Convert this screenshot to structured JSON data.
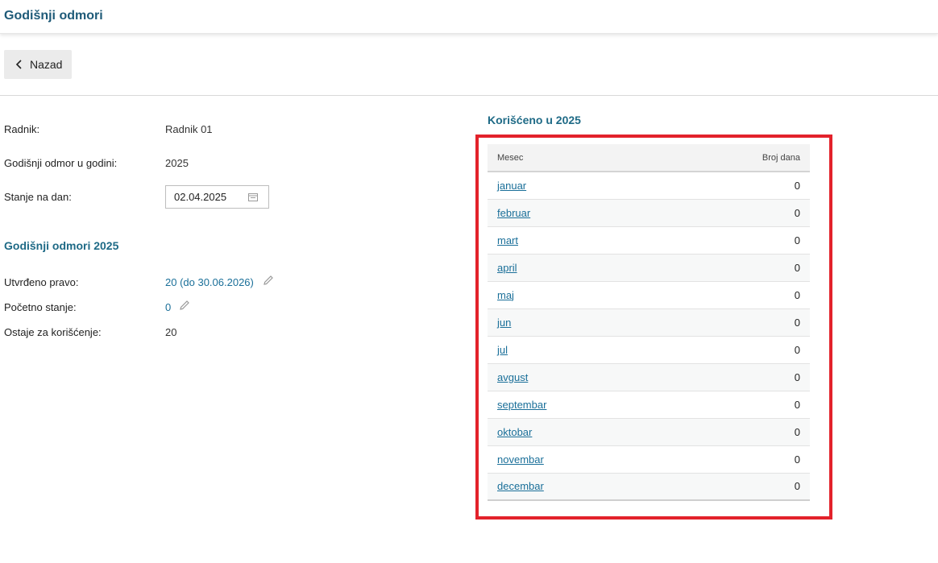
{
  "header": {
    "title": "Godišnji odmori"
  },
  "toolbar": {
    "back_label": "Nazad"
  },
  "details": {
    "worker_label": "Radnik:",
    "worker_value": "Radnik 01",
    "year_label": "Godišnji odmor u godini:",
    "year_value": "2025",
    "balance_date_label": "Stanje na dan:",
    "balance_date_value": "02.04.2025"
  },
  "summary": {
    "title": "Godišnji odmori 2025",
    "entitlement_label": "Utvrđeno pravo:",
    "entitlement_value": "20 (do 30.06.2026)",
    "opening_label": "Početno stanje:",
    "opening_value": "0",
    "remaining_label": "Ostaje za korišćenje:",
    "remaining_value": "20"
  },
  "usage": {
    "title": "Korišćeno u 2025",
    "columns": {
      "month": "Mesec",
      "days": "Broj dana"
    },
    "rows": [
      {
        "month": "januar",
        "days": "0"
      },
      {
        "month": "februar",
        "days": "0"
      },
      {
        "month": "mart",
        "days": "0"
      },
      {
        "month": "april",
        "days": "0"
      },
      {
        "month": "maj",
        "days": "0"
      },
      {
        "month": "jun",
        "days": "0"
      },
      {
        "month": "jul",
        "days": "0"
      },
      {
        "month": "avgust",
        "days": "0"
      },
      {
        "month": "septembar",
        "days": "0"
      },
      {
        "month": "oktobar",
        "days": "0"
      },
      {
        "month": "novembar",
        "days": "0"
      },
      {
        "month": "decembar",
        "days": "0"
      }
    ]
  },
  "colors": {
    "accent": "#1e5a78",
    "link": "#1a6f99",
    "highlight": "#e3222b"
  },
  "icons": {
    "back": "chevron-left-icon",
    "date": "calendar-icon",
    "edit": "pencil-icon"
  }
}
